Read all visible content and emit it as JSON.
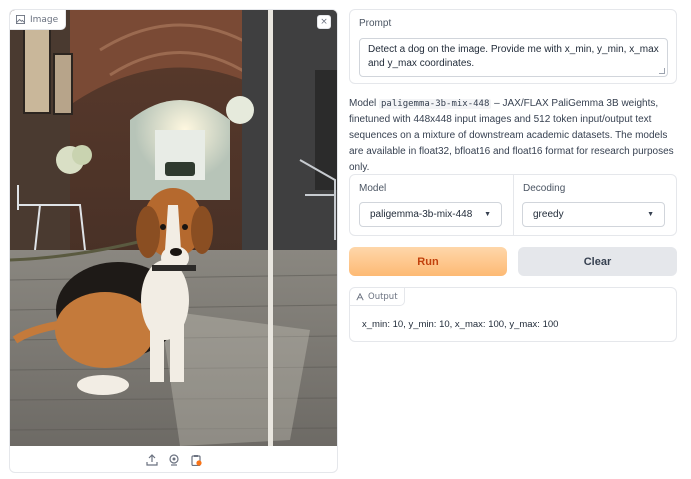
{
  "image_panel": {
    "label": "Image",
    "icons": {
      "label": "image-icon",
      "close": "close-icon",
      "upload": "upload-icon",
      "webcam": "webcam-icon",
      "clipboard": "clipboard-icon"
    },
    "close_glyph": "×"
  },
  "prompt": {
    "label": "Prompt",
    "value": "Detect a dog on the image. Provide me with x_min, y_min, x_max and y_max coordinates."
  },
  "description": {
    "prefix": "Model ",
    "model_code": "paligemma-3b-mix-448",
    "suffix": " – JAX/FLAX PaliGemma 3B weights, finetuned with 448x448 input images and 512 token input/output text sequences on a mixture of downstream academic datasets. The models are available in float32, bfloat16 and float16 format for research purposes only."
  },
  "model_select": {
    "label": "Model",
    "value": "paligemma-3b-mix-448",
    "caret": "▼"
  },
  "decoding_select": {
    "label": "Decoding",
    "value": "greedy",
    "caret": "▼"
  },
  "buttons": {
    "run": "Run",
    "clear": "Clear"
  },
  "output": {
    "label": "Output",
    "value": "x_min: 10, y_min: 10, x_max: 100, y_max: 100"
  },
  "colors": {
    "run_bg_top": "#fed7aa",
    "run_bg_bottom": "#fdba74",
    "run_text": "#c2410c",
    "clear_bg": "#e5e7eb"
  }
}
